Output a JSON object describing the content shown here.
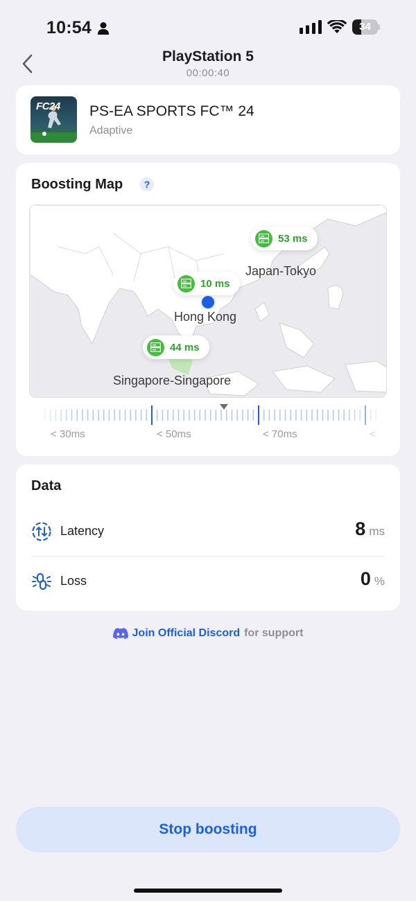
{
  "status_bar": {
    "time": "10:54",
    "battery": "34",
    "battery_level": 0.34
  },
  "header": {
    "title": "PlayStation 5",
    "timer": "00:00:40"
  },
  "game": {
    "name": "PS-EA SPORTS FC™ 24",
    "mode": "Adaptive",
    "thumb_text": "FC24"
  },
  "map": {
    "title": "Boosting Map",
    "help": "?",
    "servers": [
      {
        "city": "Japan-Tokyo",
        "latency": "53 ms"
      },
      {
        "city": "Hong Kong",
        "latency": "10 ms"
      },
      {
        "city": "Singapore-Singapore",
        "latency": "44 ms"
      }
    ],
    "slider_labels": [
      "< 30ms",
      "< 50ms",
      "< 70ms",
      "<"
    ]
  },
  "data": {
    "title": "Data",
    "latency": {
      "label": "Latency",
      "value": "8",
      "unit": "ms"
    },
    "loss": {
      "label": "Loss",
      "value": "0",
      "unit": "%"
    }
  },
  "discord": {
    "link": "Join Official Discord",
    "rest": "for support"
  },
  "stop_button": "Stop boosting",
  "colors": {
    "accent": "#1a5fe6",
    "server_green": "#3fbf3a",
    "latency_green": "#2ea52a"
  }
}
